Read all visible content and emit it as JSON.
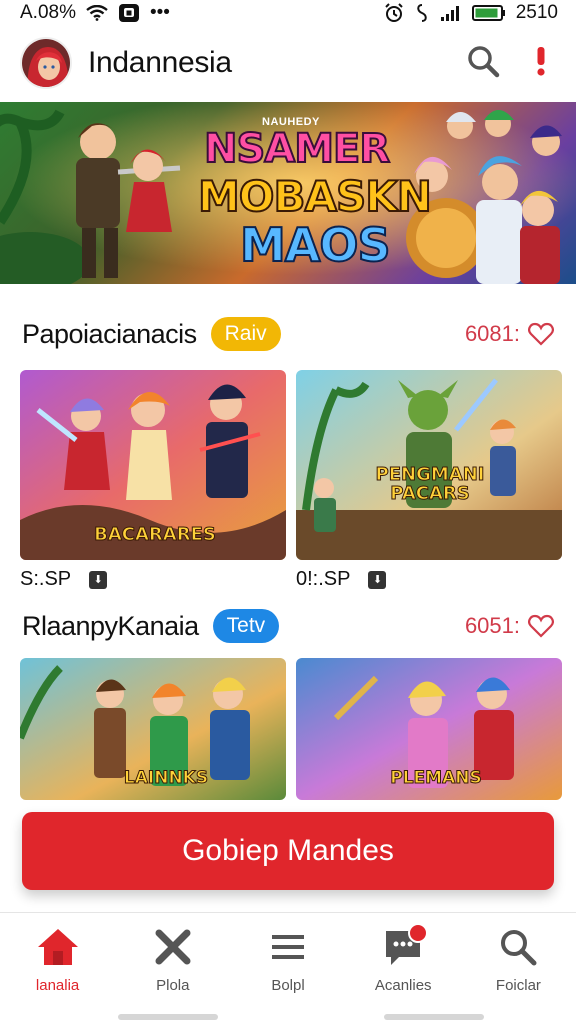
{
  "status_bar": {
    "left_text": "A.08%",
    "right_text": "2510",
    "dots": "•••"
  },
  "app_bar": {
    "title": "Indannesia"
  },
  "banner": {
    "kicker": "NAUHEDY",
    "line1": "NSAMER",
    "line2": "MOBASKN",
    "line3": "MAOS"
  },
  "sections": [
    {
      "title": "Papoiacianacis",
      "badge": "Raiv",
      "count": "6081:",
      "cards": [
        {
          "caption": "BACARARES",
          "meta": "S:.SP"
        },
        {
          "caption": "PENGMANI\nPACARS",
          "meta": "0!:.SP"
        }
      ]
    },
    {
      "title": "RlaanpyKanaia",
      "badge": "Tetv",
      "count": "6051:",
      "cards": [
        {
          "caption": "LAINNKS"
        },
        {
          "caption": "PLEMANS"
        }
      ]
    }
  ],
  "cta": {
    "label": "Gobiep Mandes"
  },
  "bottom_nav": [
    {
      "label": "lanalia",
      "icon": "home-icon",
      "active": true
    },
    {
      "label": "Plola",
      "icon": "cross-icon",
      "active": false
    },
    {
      "label": "Bolpl",
      "icon": "menu-icon",
      "active": false
    },
    {
      "label": "Acanlies",
      "icon": "chat-icon",
      "active": false
    },
    {
      "label": "Foiclar",
      "icon": "search-icon",
      "active": false
    }
  ],
  "colors": {
    "accent": "#e0262c",
    "badge_yellow": "#f2b705",
    "badge_blue": "#1e88e5",
    "count_red": "#d13b4a"
  }
}
